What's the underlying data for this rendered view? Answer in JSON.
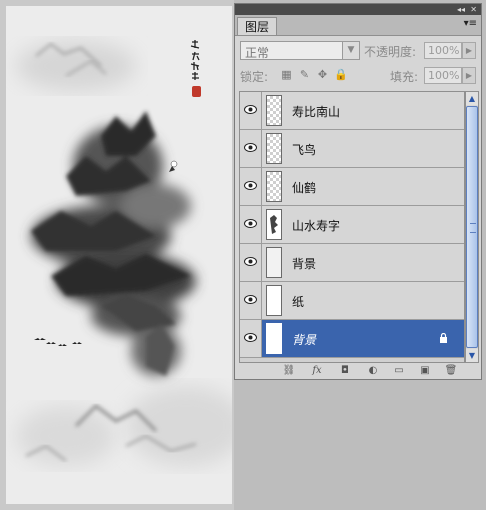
{
  "panel": {
    "collapse_glyph": "◂◂",
    "close_glyph": "✕",
    "tab_label": "图层",
    "menu_glyph": "▾≡"
  },
  "blend": {
    "mode": "正常",
    "opacity_label": "不透明度:",
    "opacity_value": "100%"
  },
  "lock": {
    "label": "锁定:",
    "fill_label": "填充:",
    "fill_value": "100%"
  },
  "layers": [
    {
      "name": "寿比南山",
      "thumb": "checker",
      "visible": true,
      "selected": false,
      "locked": false
    },
    {
      "name": "飞鸟",
      "thumb": "checker",
      "visible": true,
      "selected": false,
      "locked": false
    },
    {
      "name": "仙鹤",
      "thumb": "checker",
      "visible": true,
      "selected": false,
      "locked": false
    },
    {
      "name": "山水寿字",
      "thumb": "art",
      "visible": true,
      "selected": false,
      "locked": false
    },
    {
      "name": "背景",
      "thumb": "plain",
      "visible": true,
      "selected": false,
      "locked": false
    },
    {
      "name": "纸",
      "thumb": "white",
      "visible": true,
      "selected": false,
      "locked": false
    },
    {
      "name": "背景",
      "thumb": "white",
      "visible": true,
      "selected": true,
      "locked": true
    }
  ],
  "toolbar_icons": [
    "link-icon",
    "fx-icon",
    "mask-icon",
    "adjustment-icon",
    "folder-icon",
    "new-layer-icon",
    "trash-icon"
  ],
  "toolbar_glyphs": {
    "link": "⛓",
    "fx": "fx",
    "mask": "◘",
    "adjust": "◐",
    "folder": "▭",
    "new": "▣",
    "trash": "🗑"
  },
  "colors": {
    "selected": "#3a64ad",
    "panel_bg": "#d6d6d6",
    "seal_red": "#c0392b"
  }
}
